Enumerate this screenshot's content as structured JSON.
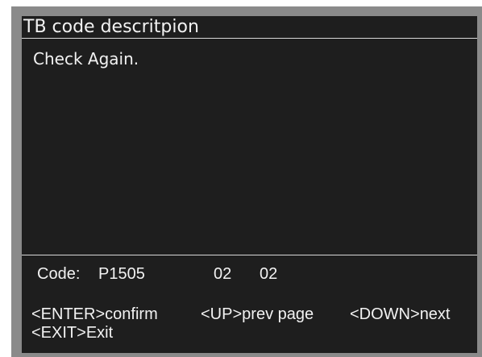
{
  "title": "TB code descritpion",
  "message": "Check Again.",
  "code": {
    "label": "Code:",
    "value": "P1505",
    "page_current": "02",
    "page_total": "02"
  },
  "keys": {
    "enter": {
      "key": "<ENTER>",
      "action": "confirm"
    },
    "up": {
      "key": "<UP>",
      "action": "prev page"
    },
    "down": {
      "key": "<DOWN>",
      "action": "next"
    },
    "exit": {
      "key": "<EXIT>",
      "action": "Exit"
    }
  },
  "colors": {
    "screen_background": "#1e1e1e",
    "frame": "#8a8a8a",
    "text": "#f2f2f2",
    "divider": "#d8d8d8"
  }
}
